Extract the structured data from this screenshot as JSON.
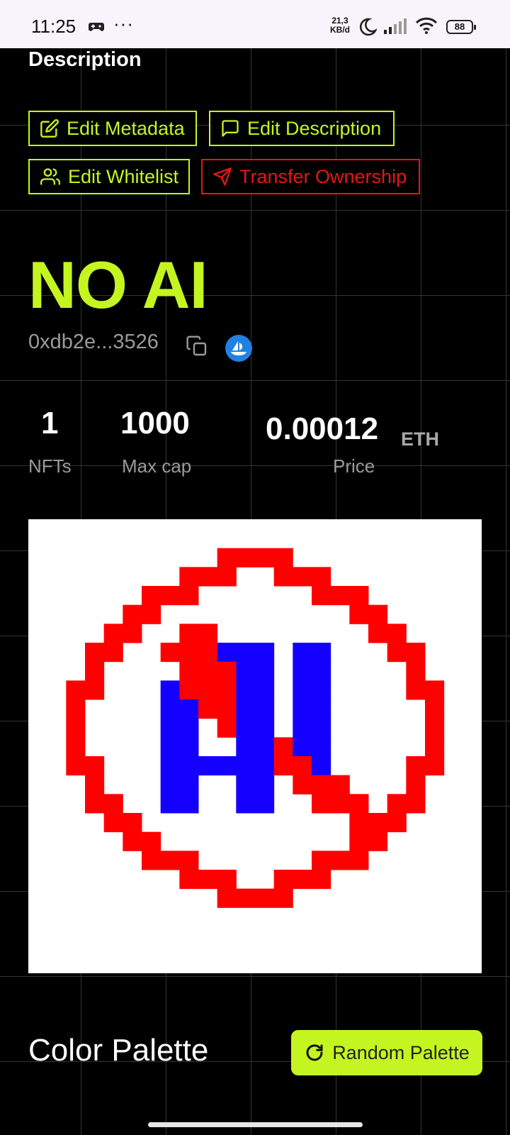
{
  "status_bar": {
    "time": "11:25",
    "dots": "···",
    "rate_value": "21,3",
    "rate_unit": "KB/d",
    "battery": "88"
  },
  "section": {
    "title": "Description"
  },
  "actions": {
    "edit_metadata": "Edit Metadata",
    "edit_description": "Edit Description",
    "edit_whitelist": "Edit Whitelist",
    "transfer_ownership": "Transfer Ownership"
  },
  "collection": {
    "name": "NO AI",
    "address": "0xdb2e...3526"
  },
  "stats": {
    "nfts_value": "1",
    "nfts_label": "NFTs",
    "maxcap_value": "1000",
    "maxcap_label": "Max cap",
    "price_value": "0.00012",
    "price_unit": "ETH",
    "price_label": "Price"
  },
  "palette": {
    "title": "Color Palette",
    "random_button": "Random Palette"
  },
  "colors": {
    "accent": "#c4f520",
    "danger": "#e81515",
    "art_red": "#ff0000",
    "art_blue": "#1400ff",
    "art_white": "#ffffff",
    "opensea_blue": "#2081e2"
  }
}
